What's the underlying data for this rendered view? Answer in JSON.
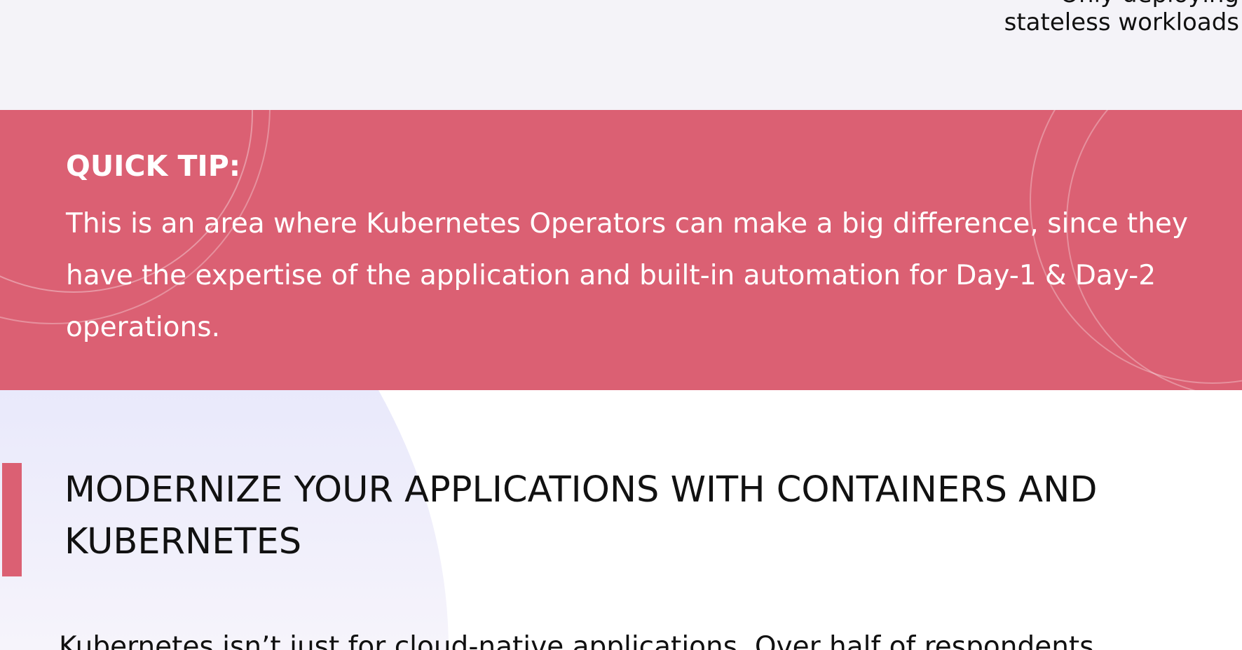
{
  "top": {
    "label_line1": "Only deploying",
    "label_line2": "stateless workloads"
  },
  "tip": {
    "title": "QUICK TIP:",
    "body": "This is an area where Kubernetes Operators can make a big difference, since they have the expertise of the application and built-in automation for Day-1 & Day-2 operations."
  },
  "section": {
    "heading": "MODERNIZE YOUR APPLICATIONS WITH CONTAINERS AND KUBERNETES",
    "body_start": "Kubernetes isn’t just for cloud-native applications. Over half of respondents"
  },
  "colors": {
    "accent": "#db6073",
    "top_band": "#f4f3f8",
    "text": "#111111"
  }
}
